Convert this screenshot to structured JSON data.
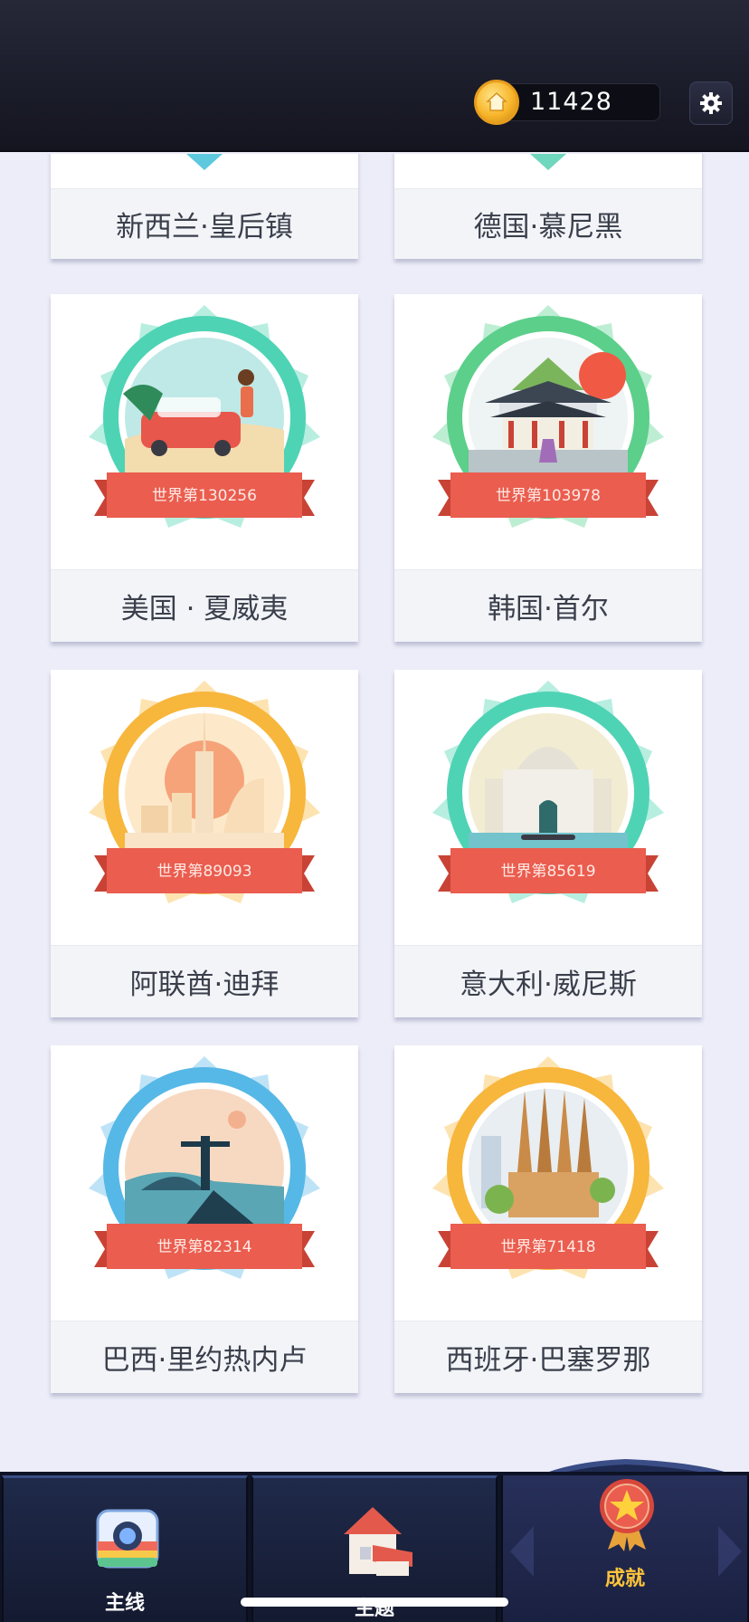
{
  "header": {
    "coin_count": "11428"
  },
  "cards": [
    {
      "name": "新西兰·皇后镇",
      "rank": "",
      "theme": "teal"
    },
    {
      "name": "德国·慕尼黑",
      "rank": "",
      "theme": "teal"
    },
    {
      "name": "美国 · 夏威夷",
      "rank": "世界第130256",
      "theme": "teal"
    },
    {
      "name": "韩国·首尔",
      "rank": "世界第103978",
      "theme": "green"
    },
    {
      "name": "阿联酋·迪拜",
      "rank": "世界第89093",
      "theme": "orange"
    },
    {
      "name": "意大利·威尼斯",
      "rank": "世界第85619",
      "theme": "teal"
    },
    {
      "name": "巴西·里约热内卢",
      "rank": "世界第82314",
      "theme": "blue"
    },
    {
      "name": "西班牙·巴塞罗那",
      "rank": "世界第71418",
      "theme": "orange"
    }
  ],
  "nav": {
    "tabs": [
      {
        "label": "主线",
        "icon": "camera-icon"
      },
      {
        "label": "主题",
        "icon": "house-icon"
      },
      {
        "label": "成就",
        "icon": "medal-star-icon"
      }
    ],
    "active": "成就"
  },
  "colors": {
    "teal": "#4fd3b5",
    "green": "#5ccf8a",
    "orange": "#f7b63c",
    "blue": "#56b8e6",
    "ribbon": "#e95c4f",
    "nav_active_text": "#ffc53a"
  }
}
